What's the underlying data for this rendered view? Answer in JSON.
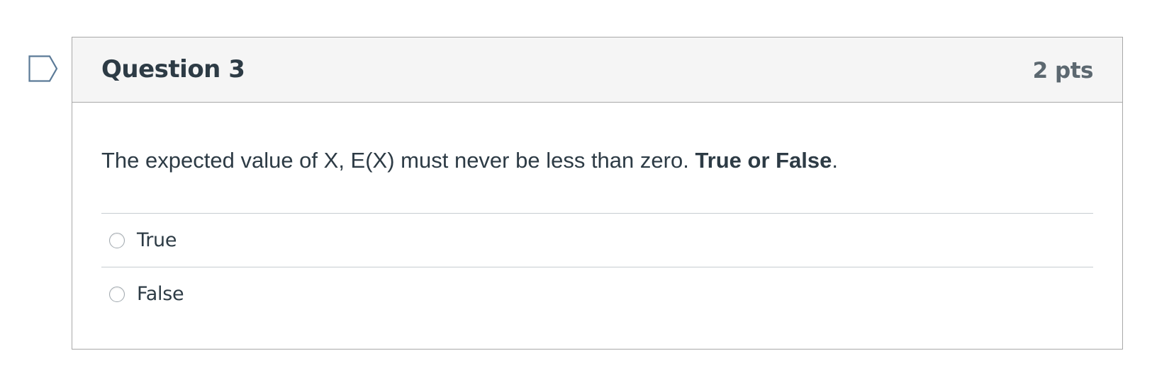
{
  "flag": {
    "icon": "bookmark-flag-icon",
    "color": "#5b7a97"
  },
  "question": {
    "title": "Question 3",
    "points": "2 pts",
    "text_prefix": "The expected value of X, E(X) must never be less than zero. ",
    "text_bold": "True or False",
    "text_suffix": ".",
    "answers": [
      {
        "label": "True",
        "selected": false
      },
      {
        "label": "False",
        "selected": false
      }
    ]
  }
}
